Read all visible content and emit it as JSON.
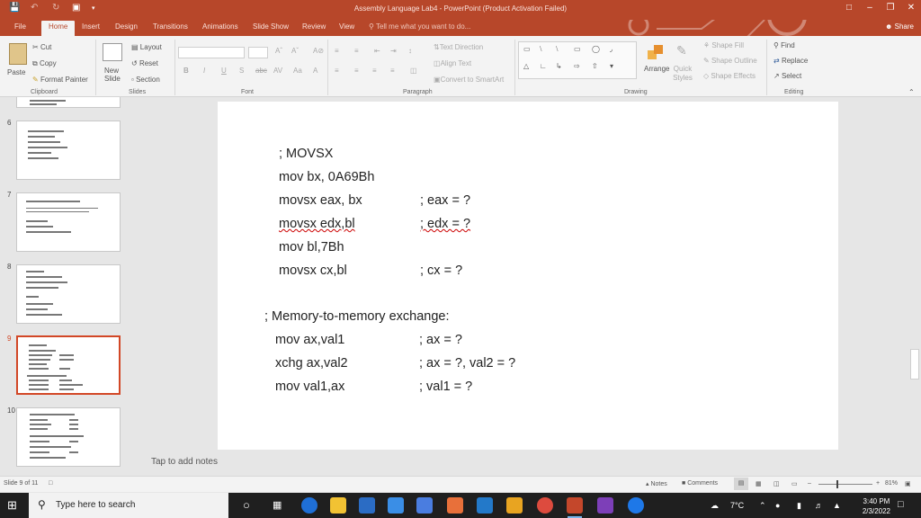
{
  "window": {
    "title": "Assembly Language Lab4 - PowerPoint (Product Activation Failed)"
  },
  "tabs": [
    "File",
    "Home",
    "Insert",
    "Design",
    "Transitions",
    "Animations",
    "Slide Show",
    "Review",
    "View"
  ],
  "tell_me": "Tell me what you want to do...",
  "share": "Share",
  "ribbon": {
    "clipboard": {
      "paste": "Paste",
      "cut": "Cut",
      "copy": "Copy",
      "format_painter": "Format Painter",
      "label": "Clipboard"
    },
    "slides": {
      "new_slide": "New Slide",
      "layout": "Layout",
      "reset": "Reset",
      "section": "Section",
      "label": "Slides"
    },
    "font": {
      "label": "Font"
    },
    "paragraph": {
      "text_direction": "Text Direction",
      "align_text": "Align Text",
      "convert_smartart": "Convert to SmartArt",
      "label": "Paragraph"
    },
    "drawing": {
      "arrange": "Arrange",
      "quick_styles": "Quick Styles",
      "shape_fill": "Shape Fill",
      "shape_outline": "Shape Outline",
      "shape_effects": "Shape Effects",
      "label": "Drawing"
    },
    "editing": {
      "find": "Find",
      "replace": "Replace",
      "select": "Select",
      "label": "Editing"
    }
  },
  "thumbnails": [
    {
      "number": "6"
    },
    {
      "number": "7"
    },
    {
      "number": "8"
    },
    {
      "number": "9"
    },
    {
      "number": "10"
    }
  ],
  "slide": {
    "lines": [
      {
        "code": ";  MOVSX",
        "comment": ""
      },
      {
        "code": "mov   bx, 0A69Bh",
        "comment": ""
      },
      {
        "code": "movsx eax, bx",
        "comment": "; eax = ?"
      },
      {
        "code": "movsx edx,bl",
        "comment": "; edx = ?"
      },
      {
        "code": "mov bl,7Bh",
        "comment": ""
      },
      {
        "code": "movsx cx,bl",
        "comment": "; cx  = ?"
      },
      {
        "code": ";  Memory-to-memory exchange:",
        "comment": ""
      },
      {
        "code": "mov  ax,val1",
        "comment": "; ax = ?"
      },
      {
        "code": "xchg ax,val2",
        "comment": "; ax = ?, val2 = ?"
      },
      {
        "code": "mov  val1,ax",
        "comment": "; val1 = ?"
      }
    ]
  },
  "notes_placeholder": "Tap to add notes",
  "status": {
    "slide_counter": "Slide 9 of 11",
    "notes": "Notes",
    "comments": "Comments",
    "zoom": "81%"
  },
  "taskbar": {
    "search_placeholder": "Type here to search",
    "temperature": "7°C",
    "time": "3:40 PM",
    "date": "2/3/2022"
  }
}
